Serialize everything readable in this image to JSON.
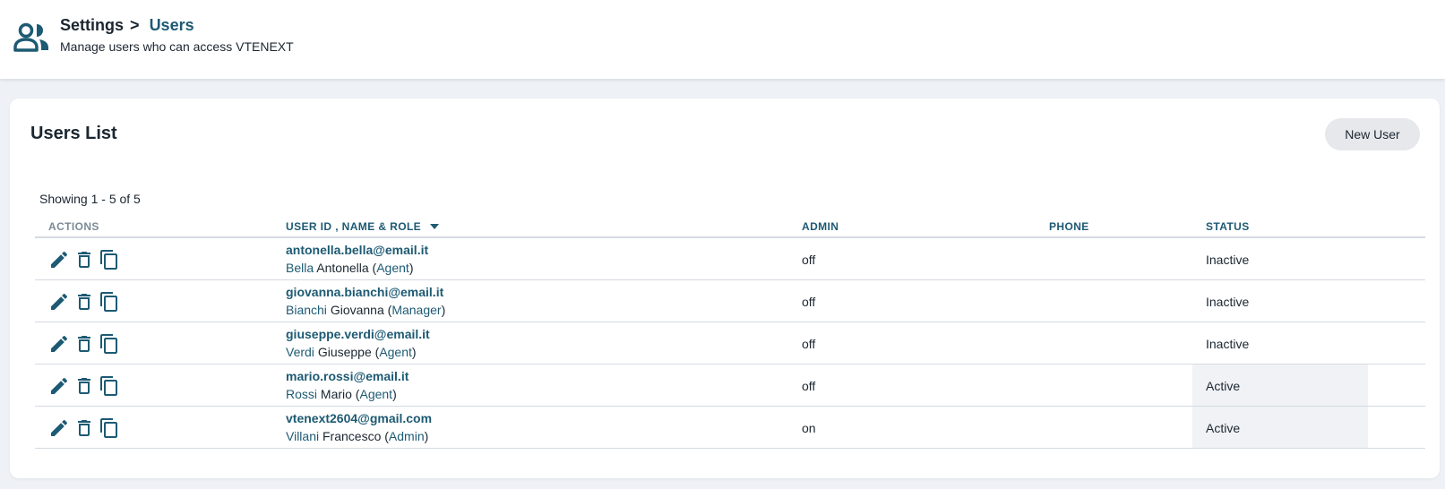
{
  "header": {
    "breadcrumb_parent": "Settings",
    "breadcrumb_separator": ">",
    "breadcrumb_current": "Users",
    "subtitle": "Manage users who can access VTENEXT",
    "icon": "users-icon"
  },
  "card": {
    "title": "Users List",
    "new_user_label": "New User",
    "showing_text": "Showing 1 - 5 of 5"
  },
  "table": {
    "columns": {
      "actions": "ACTIONS",
      "user": "USER ID , NAME & ROLE",
      "admin": "ADMIN",
      "phone": "PHONE",
      "status": "STATUS"
    },
    "sort_column": "user",
    "sort_direction": "desc",
    "rows": [
      {
        "email": "antonella.bella@email.it",
        "last": "Bella",
        "first": "Antonella",
        "role": "Agent",
        "admin": "off",
        "phone": "",
        "status": "Inactive"
      },
      {
        "email": "giovanna.bianchi@email.it",
        "last": "Bianchi",
        "first": "Giovanna",
        "role": "Manager",
        "admin": "off",
        "phone": "",
        "status": "Inactive"
      },
      {
        "email": "giuseppe.verdi@email.it",
        "last": "Verdi",
        "first": "Giuseppe",
        "role": "Agent",
        "admin": "off",
        "phone": "",
        "status": "Inactive"
      },
      {
        "email": "mario.rossi@email.it",
        "last": "Rossi",
        "first": "Mario",
        "role": "Agent",
        "admin": "off",
        "phone": "",
        "status": "Active"
      },
      {
        "email": "vtenext2604@gmail.com",
        "last": "Villani",
        "first": "Francesco",
        "role": "Admin",
        "admin": "on",
        "phone": "",
        "status": "Active"
      }
    ],
    "row_action_icons": [
      "pencil-icon",
      "trash-icon",
      "copy-icon"
    ]
  },
  "colors": {
    "accent": "#1d5a73",
    "text": "#1b2630",
    "page_bg": "#eef1f6",
    "active_status_bg": "#f0f2f5",
    "button_bg": "#e6e8eb"
  }
}
